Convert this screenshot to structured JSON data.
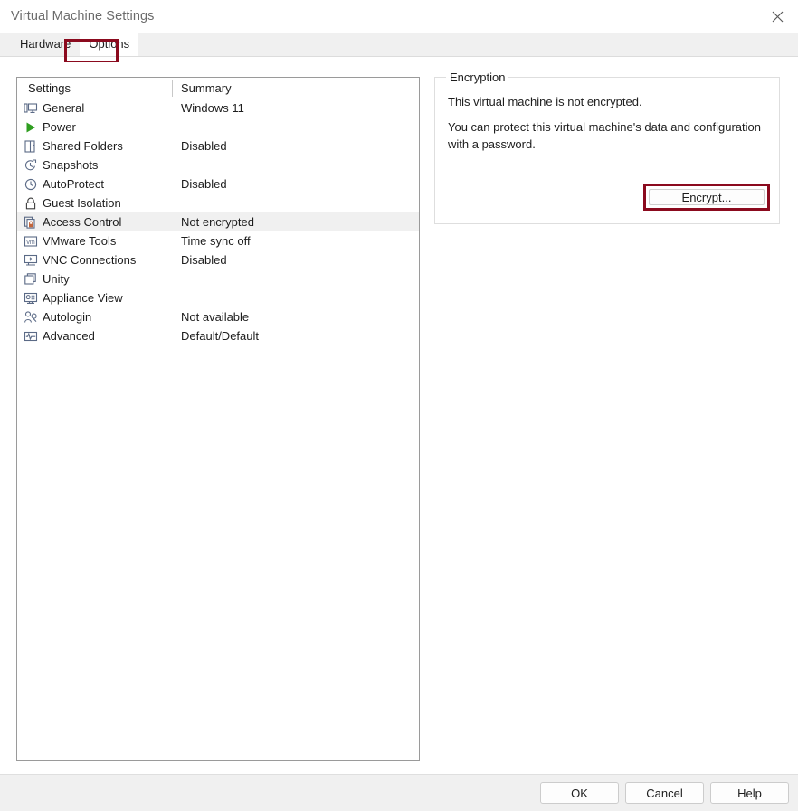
{
  "window": {
    "title": "Virtual Machine Settings",
    "close_icon": "close-icon"
  },
  "tabs": [
    {
      "label": "Hardware",
      "active": false
    },
    {
      "label": "Options",
      "active": true
    }
  ],
  "list": {
    "headers": {
      "settings": "Settings",
      "summary": "Summary"
    },
    "rows": [
      {
        "icon": "monitor-icon",
        "label": "General",
        "summary": "Windows 11",
        "selected": false
      },
      {
        "icon": "power-play-icon",
        "label": "Power",
        "summary": "",
        "selected": false
      },
      {
        "icon": "shared-folders-icon",
        "label": "Shared Folders",
        "summary": "Disabled",
        "selected": false
      },
      {
        "icon": "snapshots-icon",
        "label": "Snapshots",
        "summary": "",
        "selected": false
      },
      {
        "icon": "autoprotect-icon",
        "label": "AutoProtect",
        "summary": "Disabled",
        "selected": false
      },
      {
        "icon": "lock-icon",
        "label": "Guest Isolation",
        "summary": "",
        "selected": false
      },
      {
        "icon": "access-control-icon",
        "label": "Access Control",
        "summary": "Not encrypted",
        "selected": true
      },
      {
        "icon": "vmware-tools-icon",
        "label": "VMware Tools",
        "summary": "Time sync off",
        "selected": false
      },
      {
        "icon": "vnc-icon",
        "label": "VNC Connections",
        "summary": "Disabled",
        "selected": false
      },
      {
        "icon": "unity-icon",
        "label": "Unity",
        "summary": "",
        "selected": false
      },
      {
        "icon": "appliance-view-icon",
        "label": "Appliance View",
        "summary": "",
        "selected": false
      },
      {
        "icon": "autologin-icon",
        "label": "Autologin",
        "summary": "Not available",
        "selected": false
      },
      {
        "icon": "advanced-icon",
        "label": "Advanced",
        "summary": "Default/Default",
        "selected": false
      }
    ]
  },
  "encryption": {
    "group_title": "Encryption",
    "line1": "This virtual machine is not encrypted.",
    "line2": "You can protect this virtual machine's data and configuration with a password.",
    "encrypt_button": "Encrypt..."
  },
  "footer": {
    "ok": "OK",
    "cancel": "Cancel",
    "help": "Help"
  },
  "annotation_color": "#8b0a1e"
}
